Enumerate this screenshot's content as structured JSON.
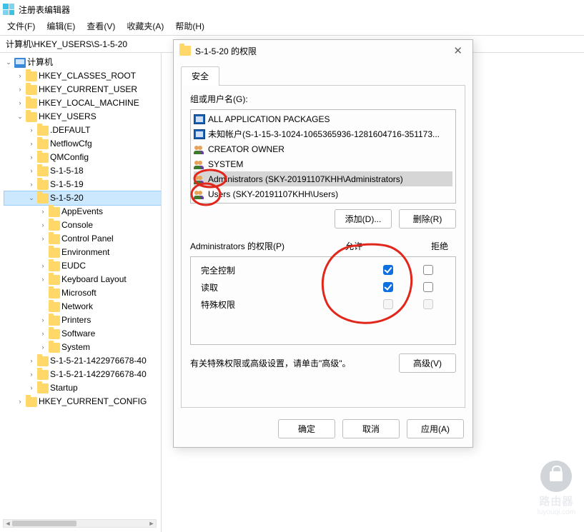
{
  "window": {
    "title": "注册表编辑器",
    "path": "计算机\\HKEY_USERS\\S-1-5-20",
    "menu": [
      "文件(F)",
      "编辑(E)",
      "查看(V)",
      "收藏夹(A)",
      "帮助(H)"
    ]
  },
  "tree": {
    "root": "计算机",
    "items": [
      {
        "label": "HKEY_CLASSES_ROOT",
        "level": 1,
        "exp": "closed"
      },
      {
        "label": "HKEY_CURRENT_USER",
        "level": 1,
        "exp": "closed"
      },
      {
        "label": "HKEY_LOCAL_MACHINE",
        "level": 1,
        "exp": "closed"
      },
      {
        "label": "HKEY_USERS",
        "level": 1,
        "exp": "open"
      },
      {
        "label": ".DEFAULT",
        "level": 2,
        "exp": "closed"
      },
      {
        "label": "NetflowCfg",
        "level": 2,
        "exp": "closed"
      },
      {
        "label": "QMConfig",
        "level": 2,
        "exp": "closed"
      },
      {
        "label": "S-1-5-18",
        "level": 2,
        "exp": "closed"
      },
      {
        "label": "S-1-5-19",
        "level": 2,
        "exp": "closed"
      },
      {
        "label": "S-1-5-20",
        "level": 2,
        "exp": "open",
        "sel": true
      },
      {
        "label": "AppEvents",
        "level": 3,
        "exp": "closed"
      },
      {
        "label": "Console",
        "level": 3,
        "exp": "closed"
      },
      {
        "label": "Control Panel",
        "level": 3,
        "exp": "closed"
      },
      {
        "label": "Environment",
        "level": 3,
        "exp": "none"
      },
      {
        "label": "EUDC",
        "level": 3,
        "exp": "closed"
      },
      {
        "label": "Keyboard Layout",
        "level": 3,
        "exp": "closed"
      },
      {
        "label": "Microsoft",
        "level": 3,
        "exp": "none"
      },
      {
        "label": "Network",
        "level": 3,
        "exp": "none"
      },
      {
        "label": "Printers",
        "level": 3,
        "exp": "closed"
      },
      {
        "label": "Software",
        "level": 3,
        "exp": "closed"
      },
      {
        "label": "System",
        "level": 3,
        "exp": "closed"
      },
      {
        "label": "S-1-5-21-1422976678-40",
        "level": 2,
        "exp": "closed"
      },
      {
        "label": "S-1-5-21-1422976678-40",
        "level": 2,
        "exp": "closed"
      },
      {
        "label": "Startup",
        "level": 2,
        "exp": "closed"
      },
      {
        "label": "HKEY_CURRENT_CONFIG",
        "level": 1,
        "exp": "closed"
      }
    ]
  },
  "dialog": {
    "title": "S-1-5-20 的权限",
    "tab": "安全",
    "group_label": "组或用户名(G):",
    "users": [
      {
        "name": "ALL APPLICATION PACKAGES",
        "kind": "app"
      },
      {
        "name": "未知帐户(S-1-15-3-1024-1065365936-1281604716-351173...",
        "kind": "app"
      },
      {
        "name": "CREATOR OWNER",
        "kind": "users"
      },
      {
        "name": "SYSTEM",
        "kind": "users"
      },
      {
        "name": "Administrators (SKY-20191107KHH\\Administrators)",
        "kind": "users",
        "sel": true
      },
      {
        "name": "Users (SKY-20191107KHH\\Users)",
        "kind": "users"
      }
    ],
    "add_btn": "添加(D)...",
    "remove_btn": "删除(R)",
    "perm_label": "Administrators 的权限(P)",
    "allow_hdr": "允许",
    "deny_hdr": "拒绝",
    "perms": [
      {
        "name": "完全控制",
        "allow": true,
        "deny": false
      },
      {
        "name": "读取",
        "allow": true,
        "deny": false
      },
      {
        "name": "特殊权限",
        "allow": false,
        "deny": false,
        "disabled": true
      }
    ],
    "spec_note": "有关特殊权限或高级设置，请单击\"高级\"。",
    "advanced_btn": "高级(V)",
    "ok": "确定",
    "cancel": "取消",
    "apply": "应用(A)"
  },
  "watermark": {
    "line1": "路由器",
    "line2": "luyouqi.com"
  }
}
